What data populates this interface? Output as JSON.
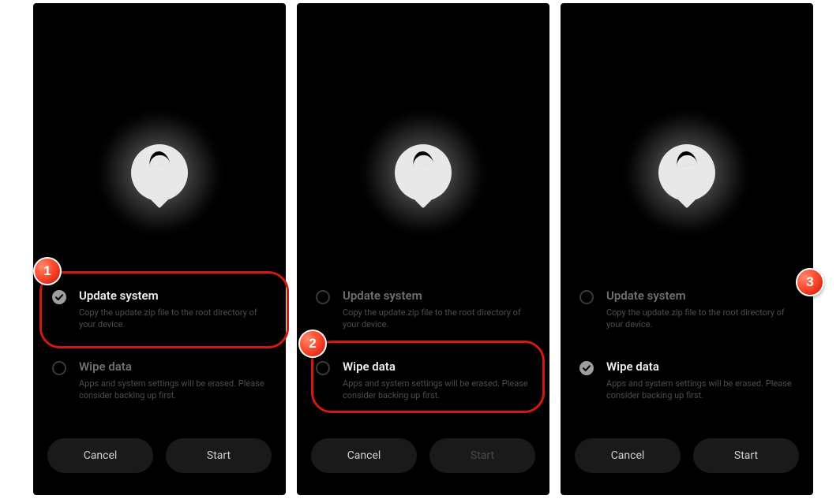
{
  "icons": {
    "logo": "flyme-drop-logo",
    "check": "checkmark-icon"
  },
  "badges": {
    "one": "1",
    "two": "2",
    "three": "3"
  },
  "options": {
    "update": {
      "title": "Update system",
      "subtitle": "Copy the update.zip file to the root directory of your device."
    },
    "wipe": {
      "title": "Wipe data",
      "subtitle": "Apps and system settings will be erased. Please consider backing up first."
    }
  },
  "buttons": {
    "cancel": "Cancel",
    "start": "Start"
  },
  "screens": [
    {
      "selected": "update",
      "start_enabled": true,
      "highlight": "update"
    },
    {
      "selected": "update",
      "start_enabled": false,
      "highlight": "wipe"
    },
    {
      "selected": "wipe",
      "start_enabled": true,
      "highlight": null
    }
  ]
}
